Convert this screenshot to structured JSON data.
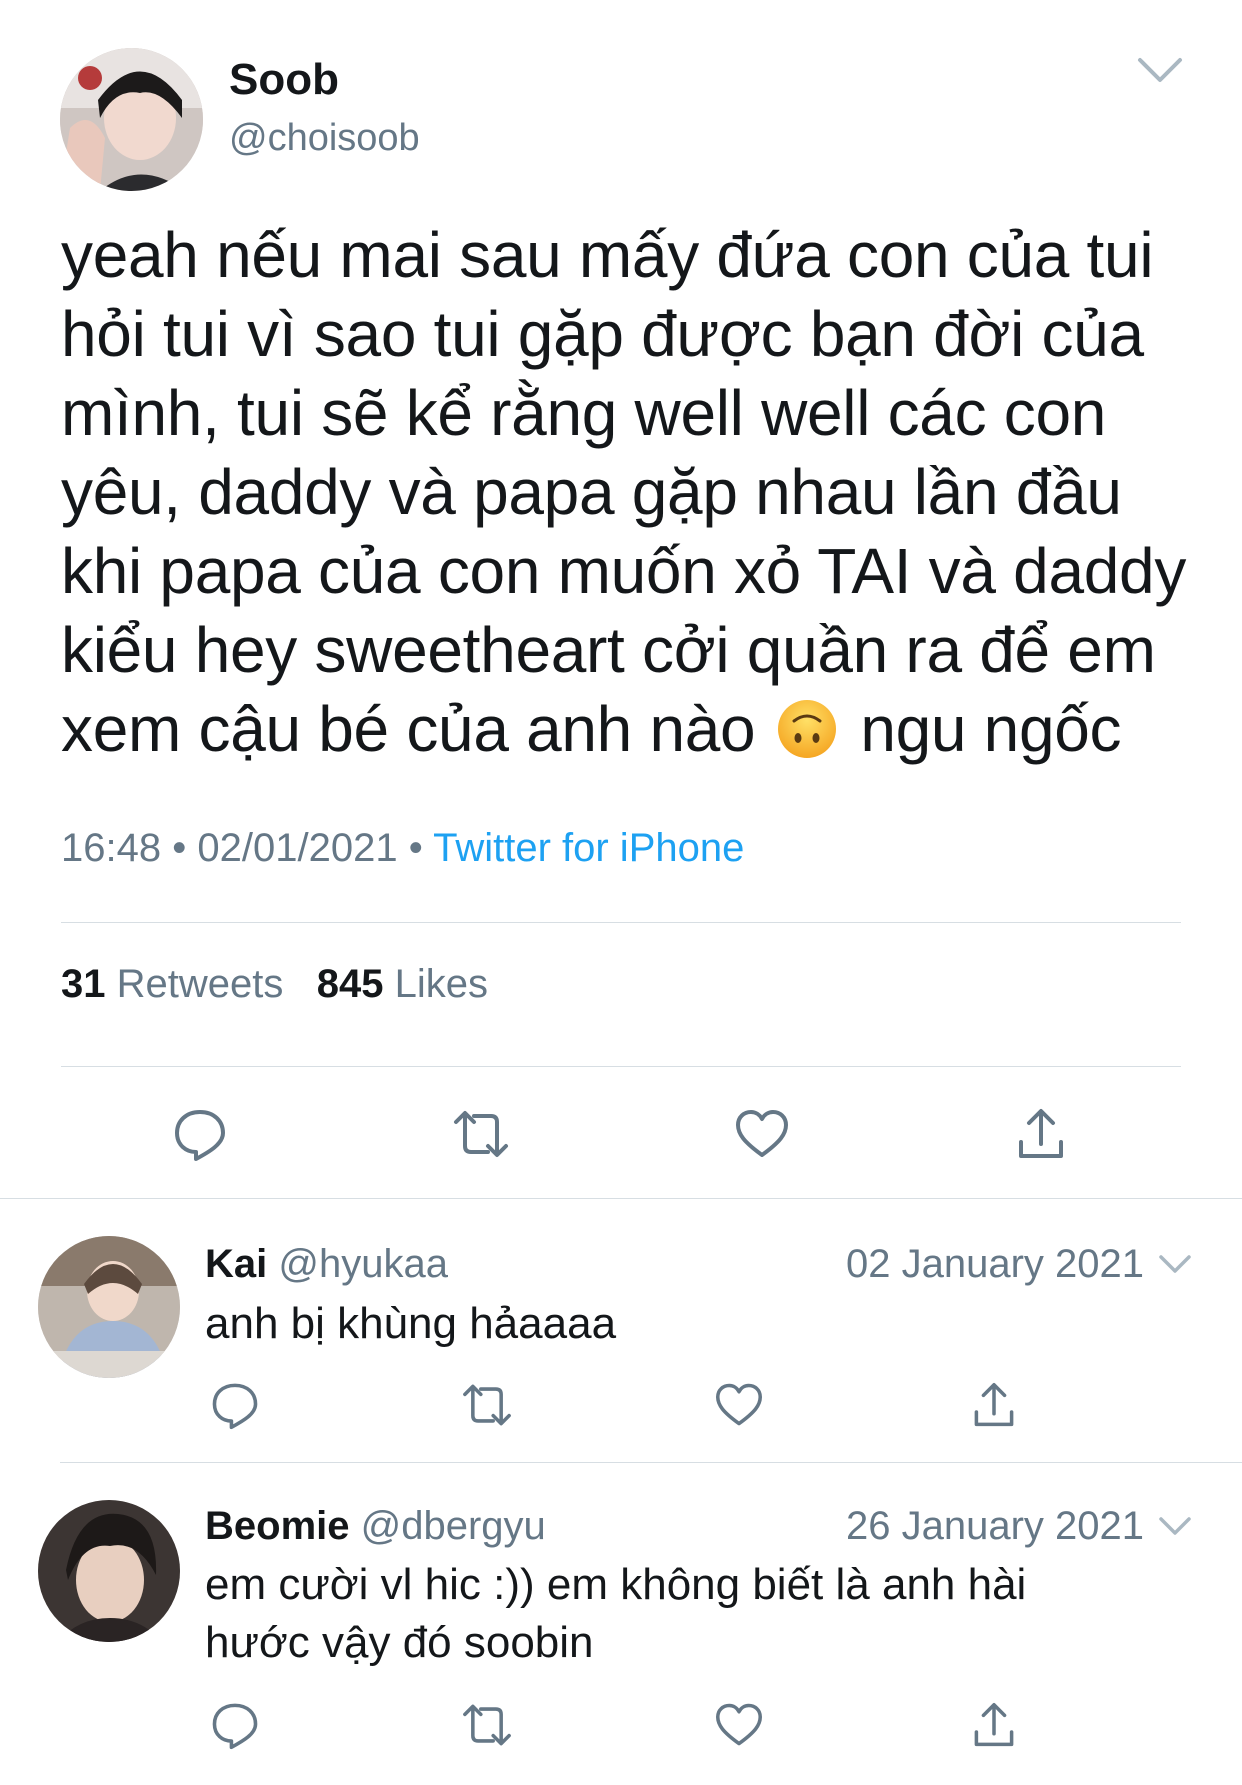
{
  "tweet": {
    "author_name": "Soob",
    "author_handle": "@choisoob",
    "text_lines": [
      "yeah nếu mai sau mấy đứa con của tui",
      "hỏi tui vì sao tui gặp được bạn đời của",
      "mình, tui sẽ kể rằng well well các con",
      "yêu, daddy và papa gặp nhau lần đầu",
      "khi papa của con muốn xỏ TAI và daddy",
      "kiểu hey sweetheart cởi quần ra để em",
      "xem cậu bé của anh nào",
      "ngu ngốc"
    ],
    "emoji": "upside-down-face-emoji",
    "time": "16:48",
    "date": "02/01/2021",
    "separator": "•",
    "source": "Twitter for iPhone",
    "retweets_count": "31",
    "retweets_label": "Retweets",
    "likes_count": "845",
    "likes_label": "Likes"
  },
  "actions": {
    "icons": [
      "reply-icon",
      "retweet-icon",
      "like-icon",
      "share-icon"
    ]
  },
  "replies": [
    {
      "name": "Kai",
      "handle": "@hyukaa",
      "date": "02 January 2021",
      "text_lines": [
        "anh bị khùng hảaaaa"
      ]
    },
    {
      "name": "Beomie",
      "handle": "@dbergyu",
      "date": "26 January 2021",
      "text_lines": [
        "em cười vl hic :)) em không biết là anh hài",
        "hước vậy đó soobin"
      ]
    }
  ],
  "colors": {
    "text": "#14171a",
    "secondary": "#657786",
    "link": "#1da1f2",
    "icon": "#657786",
    "divider": "#d7dee3"
  }
}
